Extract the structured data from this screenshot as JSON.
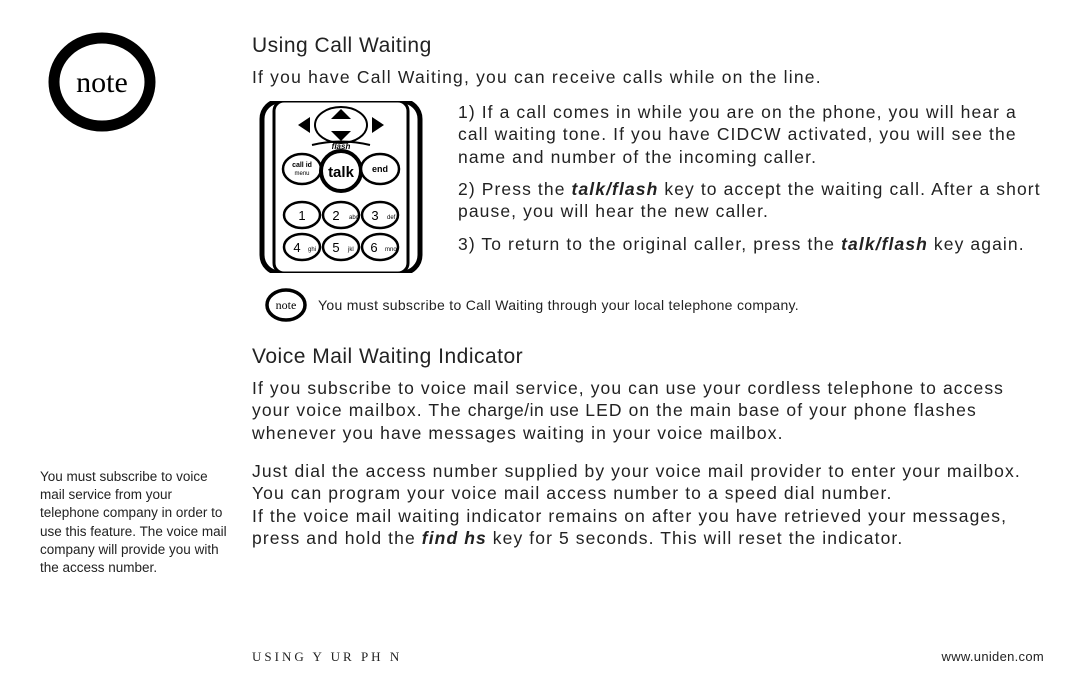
{
  "note_big_label": "note",
  "section1": {
    "heading": "Using Call Waiting",
    "intro": "If you have Call Waiting, you can receive calls while on the line.",
    "steps": {
      "s1_prefix": "1) If a call comes in while you are on the phone, you will hear a call waiting tone. If you have CIDCW activated, you will see the name and number of the incoming caller.",
      "s2_a": "2) Press the ",
      "s2_key": "talk/flash",
      "s2_b": " key to accept the waiting call. After a short pause, you will hear the new caller.",
      "s3_a": "3) To return to the original caller, press the ",
      "s3_key": "talk/flash",
      "s3_b": " key again."
    },
    "inline_note_badge": "note",
    "inline_note_text": "You must subscribe to Call Waiting through your local telephone company."
  },
  "section2": {
    "heading": "Voice Mail Waiting Indicator",
    "p1_a": "If you subscribe to voice mail service, you can use your cordless telephone to access your voice mailbox. The ",
    "p1_led": "charge/in use",
    "p1_b": " LED on the main base of your phone flashes whenever you have messages waiting in your voice mailbox.",
    "p2": "Just dial the access number supplied by your voice mail provider to enter your mailbox.",
    "p3": "You can program your voice mail access number to a speed dial number.",
    "p4_a": "If the voice mail waiting indicator remains on after you have retrieved your messages, press and hold the ",
    "p4_key": "find hs",
    "p4_b": " key for 5 seconds. This will reset the indicator."
  },
  "sidebar_note": "You must subscribe to voice mail service from your telephone company in order to use this feature. The voice mail company will provide you with the access number.",
  "footer": {
    "left": "USING Y  UR PH  N",
    "right": "www.uniden.com"
  },
  "phone": {
    "flash_label": "flash",
    "callid": "call id",
    "menu": "menu",
    "talk": "talk",
    "end": "end",
    "keys": {
      "k1": "1",
      "k2": "2",
      "k2s": "abc",
      "k3": "3",
      "k3s": "def",
      "k4": "4",
      "k4s": "ghi",
      "k5": "5",
      "k5s": "jkl",
      "k6": "6",
      "k6s": "mno"
    }
  }
}
